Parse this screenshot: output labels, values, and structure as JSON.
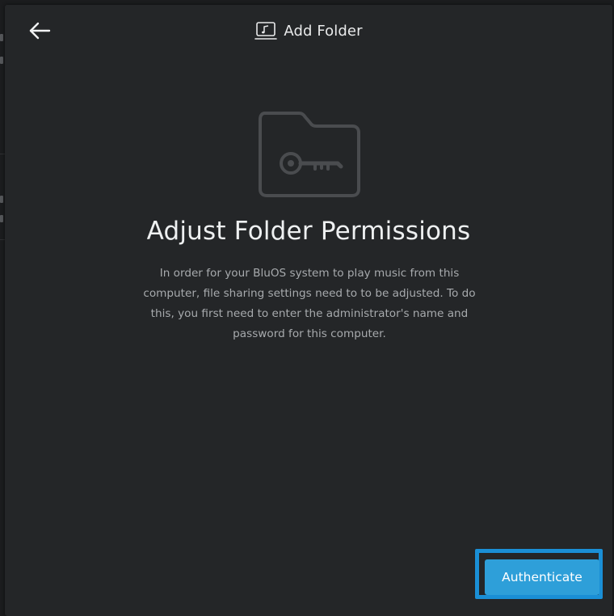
{
  "dialog": {
    "title": "Add Folder",
    "back_icon": "arrow-left-icon",
    "title_icon": "music-folder-icon"
  },
  "content": {
    "hero_icon": "folder-key-icon",
    "heading": "Adjust Folder Permissions",
    "body": "In order for your BluOS system to play music from this computer, file sharing settings need to to be adjusted. To do this, you first need to enter the administrator's name and password for this computer."
  },
  "actions": {
    "authenticate_label": "Authenticate"
  },
  "colors": {
    "background": "#242628",
    "accent": "#2e9fd9",
    "focus_ring": "#1a8fd6",
    "heading_text": "#eef0f1",
    "body_text": "#a7aaad"
  }
}
